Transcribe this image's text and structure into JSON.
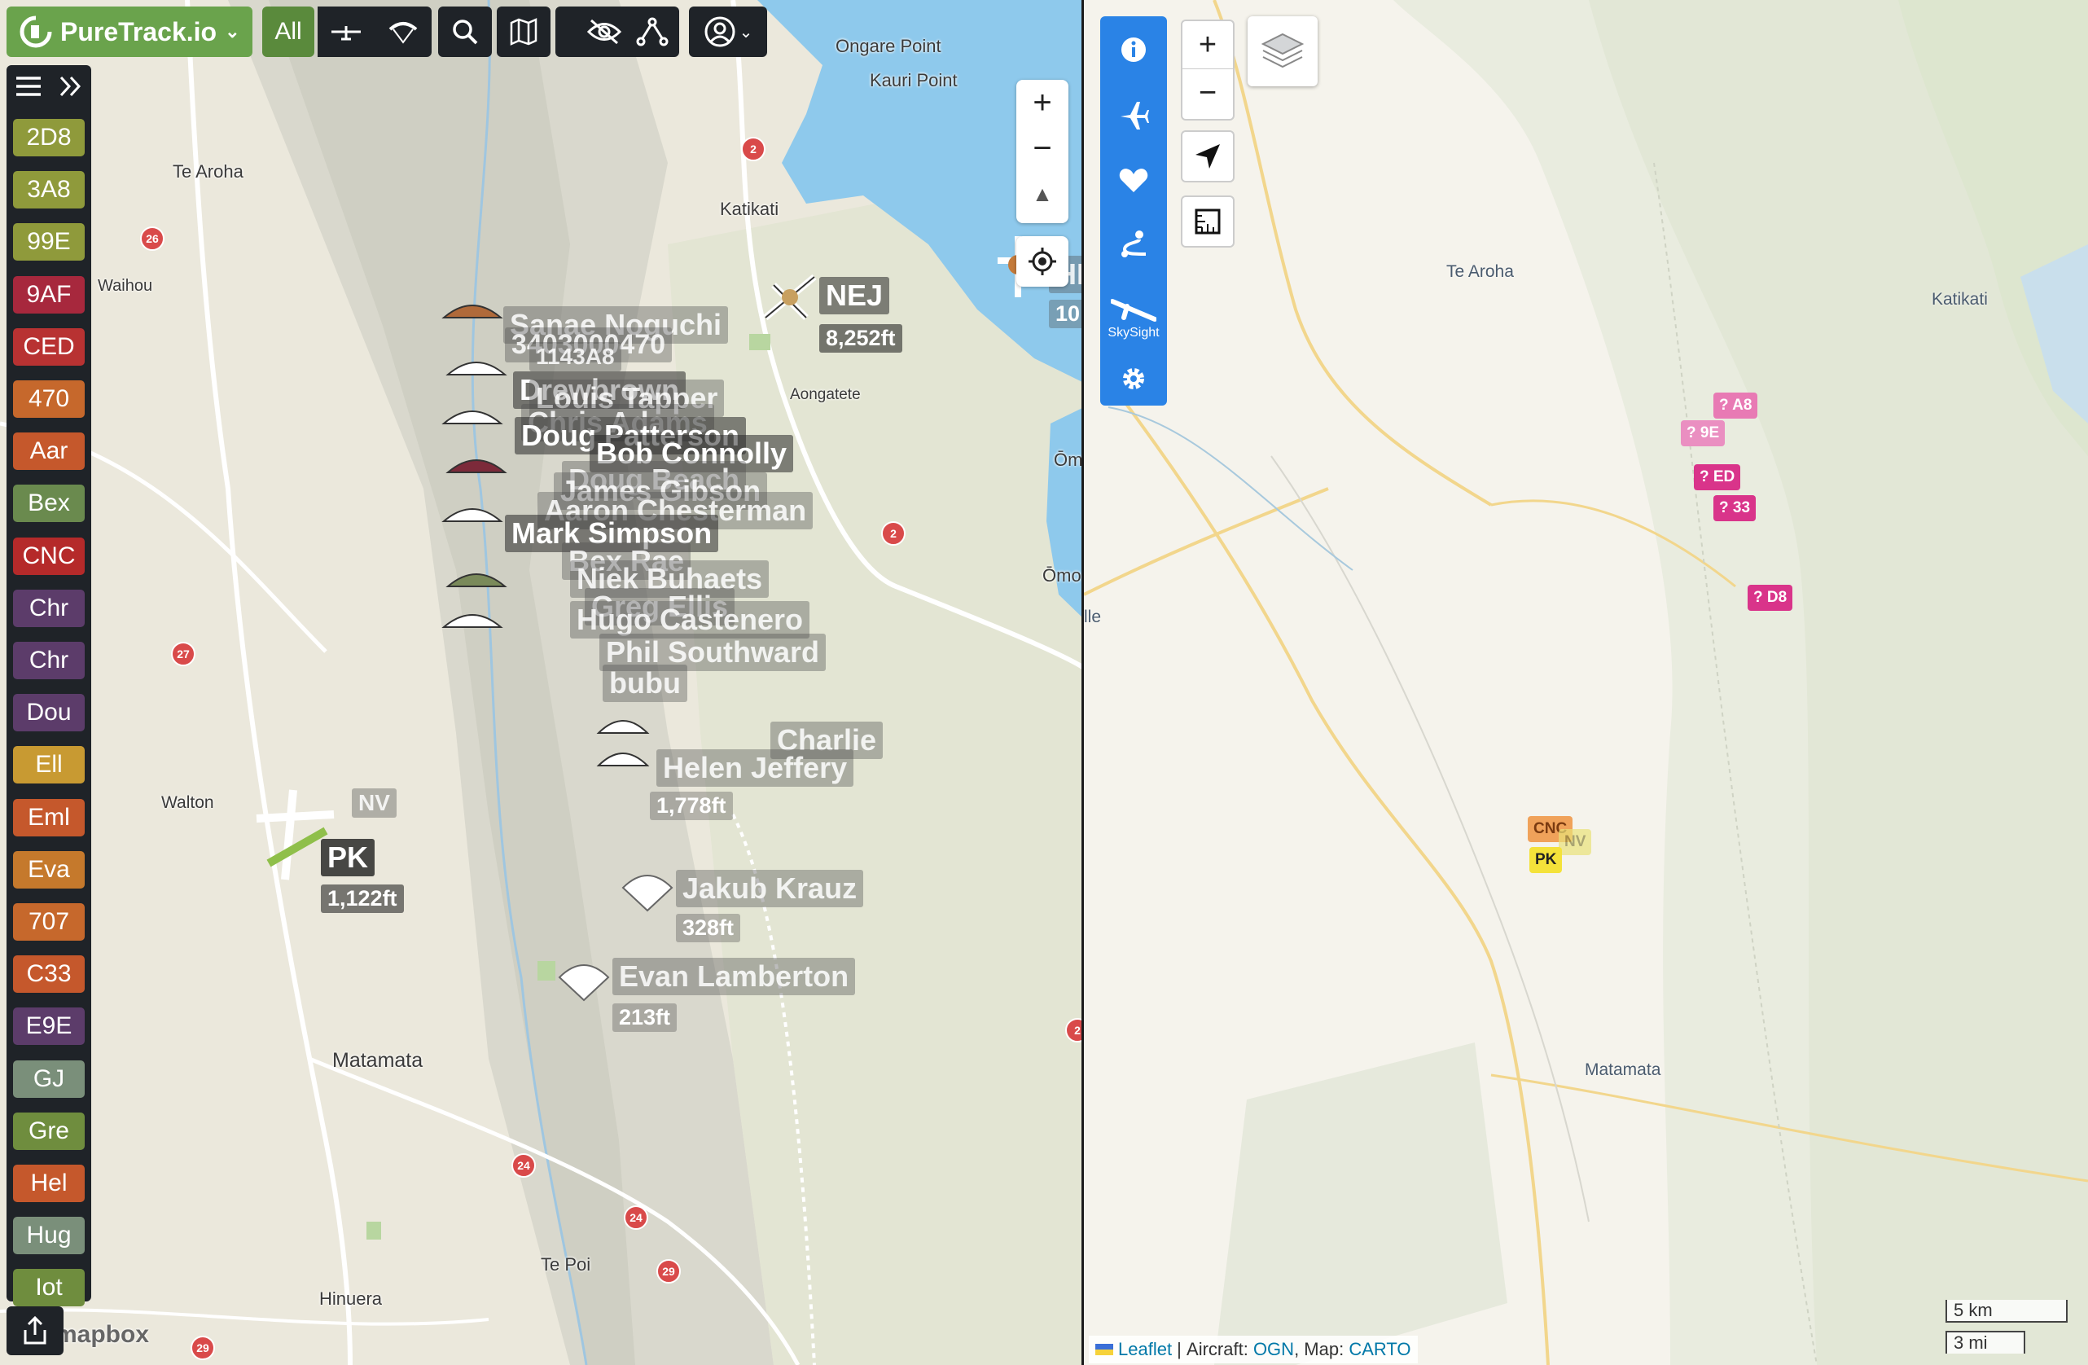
{
  "app": {
    "title": "PureTrack.io",
    "filter_all": "All"
  },
  "colors": {
    "accent_green": "#6aa34c",
    "toolbar_dark": "#1f2328",
    "panel_blue": "#2a83e6",
    "water": "#8ec9ec"
  },
  "toolbar_icons": [
    "glider-filter-icon",
    "paraglider-filter-icon",
    "search-icon",
    "map-icon",
    "hide-icon",
    "network-icon",
    "account-icon"
  ],
  "sidebar": {
    "tags": [
      {
        "label": "2D8",
        "color": "#8f9a3b"
      },
      {
        "label": "3A8",
        "color": "#8f9a3b"
      },
      {
        "label": "99E",
        "color": "#8f9a3b"
      },
      {
        "label": "9AF",
        "color": "#a7283d"
      },
      {
        "label": "CED",
        "color": "#b83232"
      },
      {
        "label": "470",
        "color": "#c6682c"
      },
      {
        "label": "Aar",
        "color": "#c5582c"
      },
      {
        "label": "Bex",
        "color": "#6a8a4e"
      },
      {
        "label": "CNC",
        "color": "#b52a2a"
      },
      {
        "label": "Chr",
        "color": "#5c3c6a"
      },
      {
        "label": "Chr",
        "color": "#5c3c6a"
      },
      {
        "label": "Dou",
        "color": "#5c3c6a"
      },
      {
        "label": "Ell",
        "color": "#c89a32"
      },
      {
        "label": "Eml",
        "color": "#c5582c"
      },
      {
        "label": "Eva",
        "color": "#c5792c"
      },
      {
        "label": "707",
        "color": "#c6682c"
      },
      {
        "label": "C33",
        "color": "#c5582c"
      },
      {
        "label": "E9E",
        "color": "#5c3c6a"
      },
      {
        "label": "GJ",
        "color": "#7a8f7a"
      },
      {
        "label": "Gre",
        "color": "#6f8d3e"
      },
      {
        "label": "Hel",
        "color": "#c5582c"
      },
      {
        "label": "Hug",
        "color": "#7a8f7a"
      },
      {
        "label": "Iot",
        "color": "#6f8d3e"
      }
    ]
  },
  "left_map": {
    "places": [
      "Ongare Point",
      "Kauri Point",
      "Te Aroha",
      "Katikati",
      "Waihou",
      "Aongatete",
      "Walton",
      "Matamata",
      "Te Poi",
      "Hinuera",
      "Ōm",
      "Ōmo",
      "mapbox"
    ],
    "road_numbers": [
      "2",
      "26",
      "27",
      "2",
      "24",
      "24",
      "29",
      "29",
      "2"
    ],
    "pilots": [
      {
        "name": "Sanae Noguchi",
        "dim": true
      },
      {
        "name": "3403000470",
        "dim": true
      },
      {
        "name": "1143A8",
        "dim": true
      },
      {
        "name": "Drewbrown",
        "dim": false
      },
      {
        "name": "Louis Tapper",
        "dim": true
      },
      {
        "name": "Chris Adams",
        "dim": true
      },
      {
        "name": "Doug Patterson",
        "dim": false
      },
      {
        "name": "Bob Connolly",
        "dim": false
      },
      {
        "name": "Doug Beach",
        "dim": true
      },
      {
        "name": "James Gibson",
        "dim": true
      },
      {
        "name": "Aaron Chesterman",
        "dim": true
      },
      {
        "name": "Mark Simpson",
        "dim": false
      },
      {
        "name": "Bex Rae",
        "dim": true
      },
      {
        "name": "Niek Buhaets",
        "dim": true
      },
      {
        "name": "Greg Ellis",
        "dim": true
      },
      {
        "name": "Hugo Castenero",
        "dim": true
      },
      {
        "name": "Phil Southward",
        "dim": true
      },
      {
        "name": "bubu",
        "dim": true
      },
      {
        "name": "Charlie",
        "dim": true
      },
      {
        "name": "Helen Jeffery",
        "dim": true
      },
      {
        "name": "Jakub Krauz",
        "dim": true
      },
      {
        "name": "Evan Lamberton",
        "dim": true
      }
    ],
    "aircraft": [
      {
        "name": "NEJ",
        "alt": "8,252ft"
      },
      {
        "name": "PK",
        "alt": "1,122ft"
      }
    ],
    "altitudes": {
      "jakub": "328ft",
      "evan": "213ft",
      "helen": "1,778ft",
      "nv": "NV",
      "hi": "HI",
      "hi_alt": "10"
    }
  },
  "right_map": {
    "places": [
      "Te Aroha",
      "Katikati",
      "Matamata",
      "lle"
    ],
    "markers": [
      {
        "label": "? A8",
        "color": "#e87ab4"
      },
      {
        "label": "? 9E",
        "color": "#ea8fc1"
      },
      {
        "label": "? ED",
        "color": "#d9348a"
      },
      {
        "label": "? 33",
        "color": "#d9348a"
      },
      {
        "label": "? D8",
        "color": "#d9348a"
      },
      {
        "label": "CNC",
        "color": "#f0a25a"
      },
      {
        "label": "NV",
        "color": "#eae37a"
      },
      {
        "label": "PK",
        "color": "#f4e23a"
      }
    ],
    "skysight_label": "SkySight",
    "attribution": {
      "leaflet": "Leaflet",
      "aircraft": "Aircraft:",
      "ogn": "OGN",
      "map": "Map:",
      "carto": "CARTO"
    },
    "scale": {
      "km": "5 km",
      "mi": "3 mi"
    }
  }
}
